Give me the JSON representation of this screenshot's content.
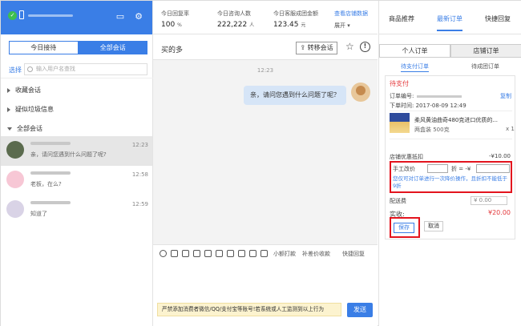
{
  "left": {
    "tabs": [
      "今日接待",
      "全部会话"
    ],
    "search": {
      "select_label": "选择",
      "placeholder": "输入用户名查找"
    },
    "groups": [
      "收藏会话",
      "疑似垃圾信息",
      "全部会话"
    ],
    "conversations": [
      {
        "message": "亲，请问您遇到什么问题了呢?",
        "time": "12:23"
      },
      {
        "message": "老板，在么?",
        "time": "12:58"
      },
      {
        "message": "知道了",
        "time": "12:59"
      }
    ]
  },
  "stats": [
    {
      "label": "今日回复率",
      "value": "100",
      "unit": "%"
    },
    {
      "label": "今日咨询人数",
      "value": "222,222",
      "unit": "人"
    },
    {
      "label": "今日客服成团金额",
      "value": "123.45",
      "unit": "元"
    }
  ],
  "stats_link": "查看店铺数据",
  "stats_expand": "展开 ▾",
  "chat": {
    "title": "买的多",
    "transfer_button": "转移会话",
    "timestamp": "12:23",
    "bubble": "亲，请问您遇到什么问题了呢？",
    "toolbar": {
      "small_pay": "小额打款",
      "price_diff": "补差价收款",
      "quick_reply": "快捷回复"
    },
    "warning": "严禁添加消费者微信/QQ/支付宝等账号!若系统或人工监测到以上行为",
    "send": "发送"
  },
  "right": {
    "tabs": [
      "商品推荐",
      "最新订单",
      "快捷回复"
    ],
    "subtabs": [
      "个人订单",
      "店铺订单"
    ],
    "order_tabs": [
      "待支付订单",
      "待成团订单"
    ],
    "order": {
      "status": "待支付",
      "order_no_label": "订单编号:",
      "copy": "复制",
      "time": "下单时间: 2017-08-09 12:49",
      "goods_name": "柔风黄油曲奇480克进口优质的...",
      "goods_sku": "两盒装 500克",
      "goods_qty": "x 1",
      "discount_label": "店铺优惠抵扣",
      "discount_value": "-¥10.00",
      "manual_label": "手工改价",
      "manual_mid": "折 = -¥",
      "manual_tip": "您仅可对订单进行一次降价操作，且折扣不能低于9折",
      "shipping_label": "配送费",
      "shipping_value": "¥ 0.00",
      "actual_label": "实收:",
      "actual_value": "¥20.00",
      "save": "保存",
      "cancel": "取消"
    }
  },
  "colors": {
    "primary": "#3a7ee6",
    "danger": "#e3141e",
    "warning_bg": "#fcf3cf"
  }
}
